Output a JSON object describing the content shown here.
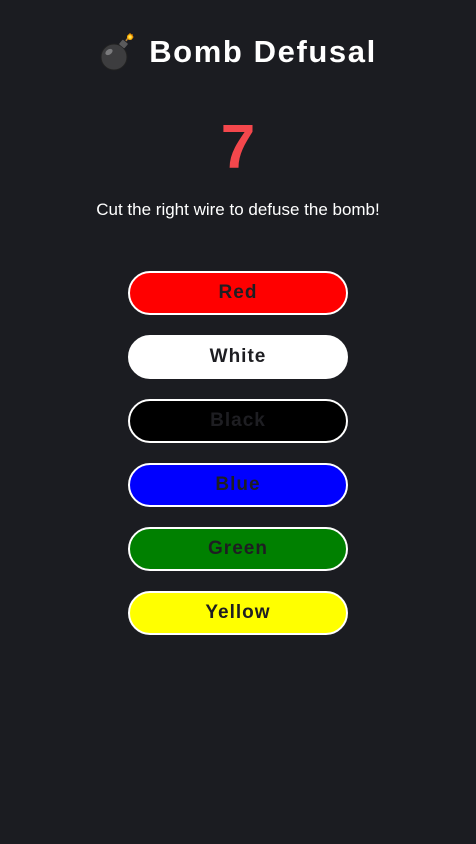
{
  "header": {
    "icon": "bomb-icon",
    "title": "Bomb Defusal"
  },
  "timer": {
    "value": "7",
    "color": "#f4474c"
  },
  "instruction": "Cut the right wire to defuse the bomb!",
  "wires": [
    {
      "label": "Red",
      "color": "#ff0000"
    },
    {
      "label": "White",
      "color": "#ffffff"
    },
    {
      "label": "Black",
      "color": "#000000"
    },
    {
      "label": "Blue",
      "color": "#0000ff"
    },
    {
      "label": "Green",
      "color": "#008000"
    },
    {
      "label": "Yellow",
      "color": "#ffff00"
    }
  ]
}
